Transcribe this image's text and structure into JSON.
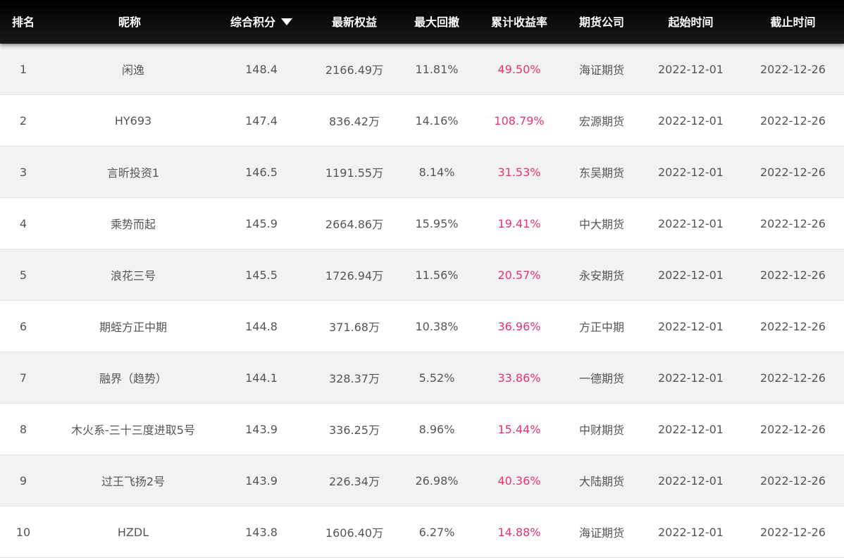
{
  "header": {
    "rank": "排名",
    "nickname": "昵称",
    "score": "综合积分",
    "equity": "最新权益",
    "max_drawdown": "最大回撤",
    "cum_return": "累计收益率",
    "firm": "期货公司",
    "start_time": "起始时间",
    "end_time": "截止时间"
  },
  "rows": [
    {
      "rank": "1",
      "nickname": "闲逸",
      "score": "148.4",
      "equity": "2166.49万",
      "max_drawdown": "11.81%",
      "cum_return": "49.50%",
      "firm": "海证期货",
      "start_time": "2022-12-01",
      "end_time": "2022-12-26"
    },
    {
      "rank": "2",
      "nickname": "HY693",
      "score": "147.4",
      "equity": "836.42万",
      "max_drawdown": "14.16%",
      "cum_return": "108.79%",
      "firm": "宏源期货",
      "start_time": "2022-12-01",
      "end_time": "2022-12-26"
    },
    {
      "rank": "3",
      "nickname": "言昕投资1",
      "score": "146.5",
      "equity": "1191.55万",
      "max_drawdown": "8.14%",
      "cum_return": "31.53%",
      "firm": "东吴期货",
      "start_time": "2022-12-01",
      "end_time": "2022-12-26"
    },
    {
      "rank": "4",
      "nickname": "乘势而起",
      "score": "145.9",
      "equity": "2664.86万",
      "max_drawdown": "15.95%",
      "cum_return": "19.41%",
      "firm": "中大期货",
      "start_time": "2022-12-01",
      "end_time": "2022-12-26"
    },
    {
      "rank": "5",
      "nickname": "浪花三号",
      "score": "145.5",
      "equity": "1726.94万",
      "max_drawdown": "11.56%",
      "cum_return": "20.57%",
      "firm": "永安期货",
      "start_time": "2022-12-01",
      "end_time": "2022-12-26"
    },
    {
      "rank": "6",
      "nickname": "期蛭方正中期",
      "score": "144.8",
      "equity": "371.68万",
      "max_drawdown": "10.38%",
      "cum_return": "36.96%",
      "firm": "方正中期",
      "start_time": "2022-12-01",
      "end_time": "2022-12-26"
    },
    {
      "rank": "7",
      "nickname": "融界（趋势）",
      "score": "144.1",
      "equity": "328.37万",
      "max_drawdown": "5.52%",
      "cum_return": "33.86%",
      "firm": "一德期货",
      "start_time": "2022-12-01",
      "end_time": "2022-12-26"
    },
    {
      "rank": "8",
      "nickname": "木火系-三十三度进取5号",
      "score": "143.9",
      "equity": "336.25万",
      "max_drawdown": "8.96%",
      "cum_return": "15.44%",
      "firm": "中财期货",
      "start_time": "2022-12-01",
      "end_time": "2022-12-26"
    },
    {
      "rank": "9",
      "nickname": "过王飞扬2号",
      "score": "143.9",
      "equity": "226.34万",
      "max_drawdown": "26.98%",
      "cum_return": "40.36%",
      "firm": "大陆期货",
      "start_time": "2022-12-01",
      "end_time": "2022-12-26"
    },
    {
      "rank": "10",
      "nickname": "HZDL",
      "score": "143.8",
      "equity": "1606.40万",
      "max_drawdown": "6.27%",
      "cum_return": "14.88%",
      "firm": "海证期货",
      "start_time": "2022-12-01",
      "end_time": "2022-12-26"
    }
  ],
  "colors": {
    "header_bg": "#000000",
    "return_color": "#e8336d",
    "row_alt_bg": "#f2f2f2"
  },
  "sort": {
    "column": "score",
    "direction": "desc",
    "icon": "caret-down-icon"
  }
}
